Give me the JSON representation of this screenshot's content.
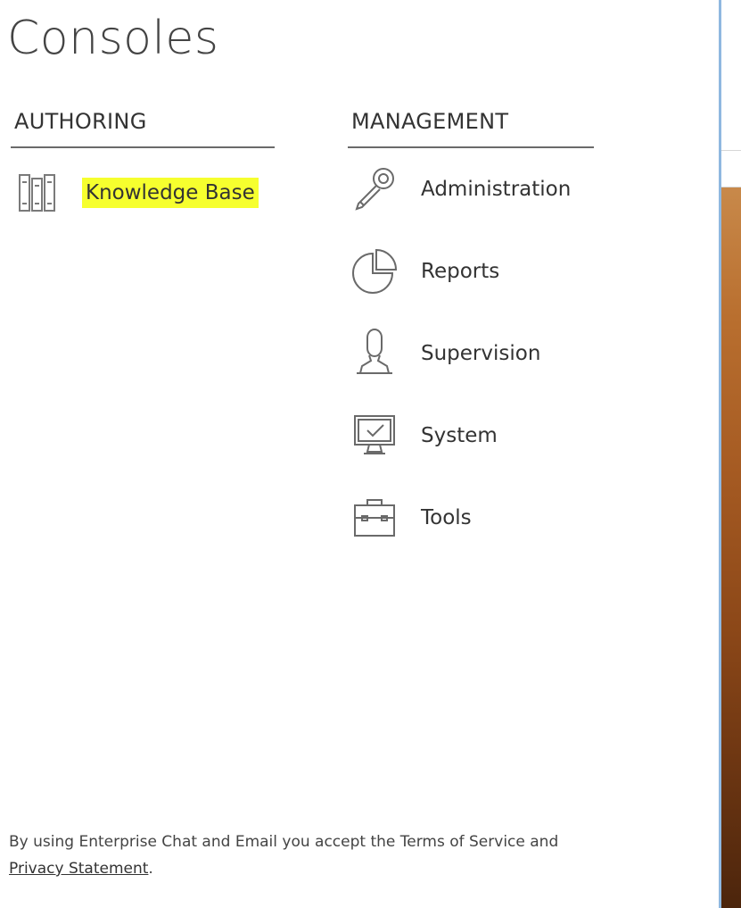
{
  "page": {
    "title": "Consoles"
  },
  "authoring": {
    "header": "AUTHORING",
    "items": [
      {
        "label": "Knowledge Base",
        "icon": "books-icon",
        "highlighted": true
      }
    ]
  },
  "management": {
    "header": "MANAGEMENT",
    "items": [
      {
        "label": "Administration",
        "icon": "key-icon"
      },
      {
        "label": "Reports",
        "icon": "pie-chart-icon"
      },
      {
        "label": "Supervision",
        "icon": "supervisor-icon"
      },
      {
        "label": "System",
        "icon": "monitor-icon"
      },
      {
        "label": "Tools",
        "icon": "toolbox-icon"
      }
    ]
  },
  "footer": {
    "text_before": "By using Enterprise Chat and Email you accept the Terms of Service and",
    "privacy_link": "Privacy Statement",
    "text_after": "."
  },
  "colors": {
    "highlight": "#f6ff2e",
    "text": "#333333",
    "divider": "#6a6a6a"
  }
}
